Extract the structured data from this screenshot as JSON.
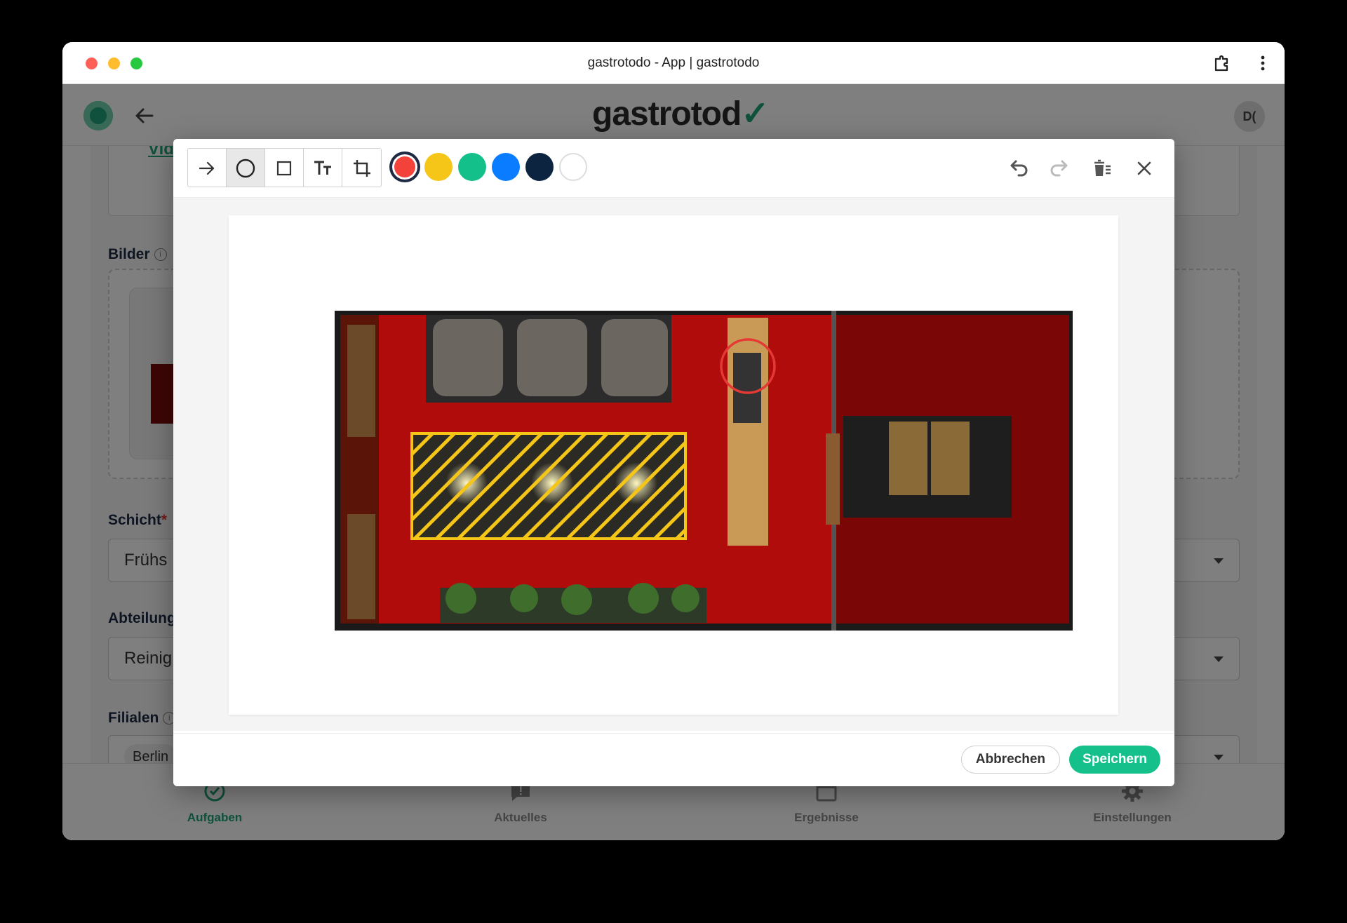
{
  "window": {
    "title": "gastrotodo - App | gastrotodo"
  },
  "app": {
    "brand": "gastrotod",
    "avatar_initials": "D(",
    "video_link": "Vid",
    "sections": {
      "images_label": "Bilder",
      "shift_label": "Schicht",
      "shift_value": "Frühs",
      "department_label": "Abteilung",
      "department_value": "Reinig",
      "branches_label": "Filialen",
      "branches_chip": "Berlin"
    },
    "nav": [
      {
        "label": "Aufgaben",
        "icon": "check-circle-icon"
      },
      {
        "label": "Aktuelles",
        "icon": "message-alert-icon"
      },
      {
        "label": "Ergebnisse",
        "icon": "calendar-icon"
      },
      {
        "label": "Einstellungen",
        "icon": "gear-icon"
      }
    ]
  },
  "editor": {
    "tools": [
      {
        "name": "arrow-tool",
        "icon": "arrow-right-icon"
      },
      {
        "name": "circle-tool",
        "icon": "circle-icon",
        "active": true
      },
      {
        "name": "rectangle-tool",
        "icon": "square-icon"
      },
      {
        "name": "text-tool",
        "icon": "text-size-icon"
      },
      {
        "name": "crop-tool",
        "icon": "crop-icon"
      }
    ],
    "colors": [
      "#f2423a",
      "#f5c518",
      "#13c08a",
      "#0a7cff",
      "#0d2440",
      "#ffffff"
    ],
    "selected_color": "#f2423a",
    "actions": [
      "undo-icon",
      "redo-icon",
      "delete-icon",
      "close-icon"
    ],
    "cancel_label": "Abbrechen",
    "save_label": "Speichern"
  }
}
